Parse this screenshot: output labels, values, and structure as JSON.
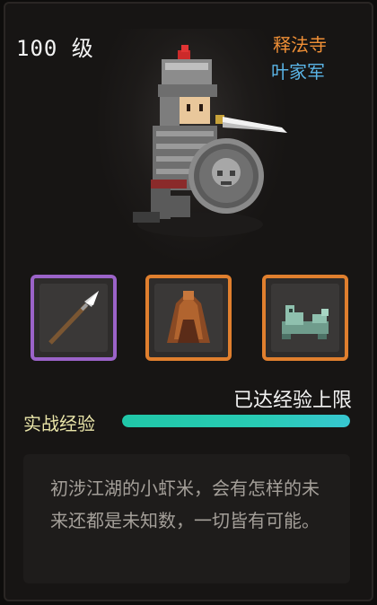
{
  "character": {
    "level": "100 级",
    "sect": "释法寺",
    "faction": "叶家军",
    "sect_color": "#ef8f36",
    "faction_color": "#5ab4e6",
    "portrait_icon": "armored-general-with-shield-and-sword"
  },
  "equipment": [
    {
      "slot": "weapon",
      "icon": "spear-icon",
      "rarity_color": "#9b63c8"
    },
    {
      "slot": "armor",
      "icon": "cloak-icon",
      "rarity_color": "#e07f2e"
    },
    {
      "slot": "accessory",
      "icon": "jade-beast-icon",
      "rarity_color": "#e07f2e"
    }
  ],
  "experience": {
    "label": "实战经验",
    "status": "已达经验上限",
    "progress": 1.0,
    "bar_color": "#28cbb4"
  },
  "description": "初涉江湖的小虾米，会有怎样的未来还都是未知数，一切皆有可能。"
}
